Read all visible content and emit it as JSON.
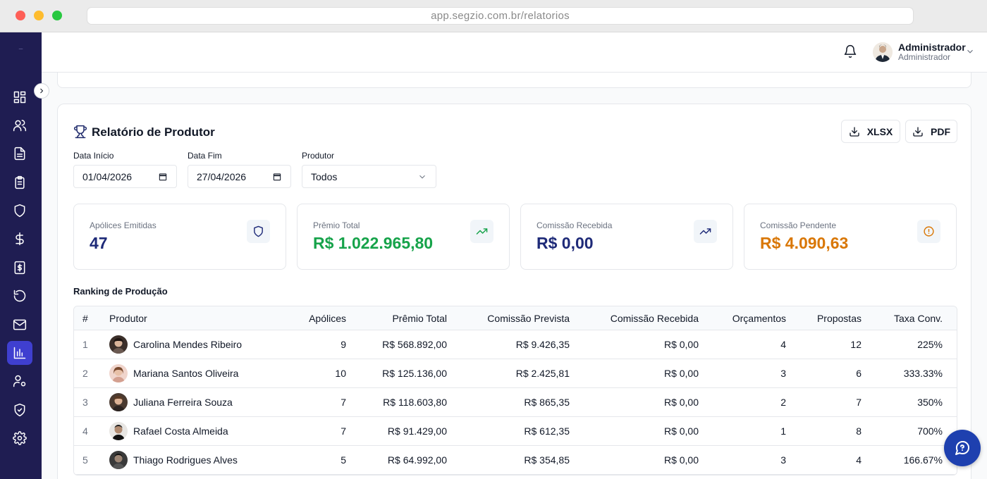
{
  "browser": {
    "url": "app.segzio.com.br/relatorios"
  },
  "sidebar": {
    "logo": "–",
    "items": [
      {
        "icon": "dashboard-icon",
        "active": false
      },
      {
        "icon": "users-icon",
        "active": false
      },
      {
        "icon": "document-icon",
        "active": false
      },
      {
        "icon": "clipboard-icon",
        "active": false
      },
      {
        "icon": "shield-icon",
        "active": false
      },
      {
        "icon": "dollar-icon",
        "active": false
      },
      {
        "icon": "money-doc-icon",
        "active": false
      },
      {
        "icon": "history-icon",
        "active": false
      },
      {
        "icon": "mail-icon",
        "active": false
      },
      {
        "icon": "bar-chart-icon",
        "active": true
      },
      {
        "icon": "user-settings-icon",
        "active": false
      },
      {
        "icon": "shield-check-icon",
        "active": false
      },
      {
        "icon": "gear-icon",
        "active": false
      }
    ]
  },
  "header": {
    "user_name": "Administrador",
    "user_role": "Administrador"
  },
  "report": {
    "title": "Relatório de Produtor",
    "export_xlsx": "XLSX",
    "export_pdf": "PDF",
    "filters": {
      "start_label": "Data Início",
      "start_value": "01/04/2026",
      "end_label": "Data Fim",
      "end_value": "27/04/2026",
      "producer_label": "Produtor",
      "producer_value": "Todos"
    },
    "kpis": [
      {
        "label": "Apólices Emitidas",
        "value": "47",
        "color": "#1e2a78",
        "icon": "shield-icon"
      },
      {
        "label": "Prêmio Total",
        "value": "R$ 1.022.965,80",
        "color": "#16a34a",
        "icon": "trending-up-icon"
      },
      {
        "label": "Comissão Recebida",
        "value": "R$ 0,00",
        "color": "#1e2a78",
        "icon": "trending-up-icon"
      },
      {
        "label": "Comissão Pendente",
        "value": "R$ 4.090,63",
        "color": "#d97706",
        "icon": "alert-circle-icon"
      }
    ],
    "ranking_title": "Ranking de Produção",
    "columns": [
      "#",
      "Produtor",
      "Apólices",
      "Prêmio Total",
      "Comissão Prevista",
      "Comissão Recebida",
      "Orçamentos",
      "Propostas",
      "Taxa Conv."
    ],
    "rows": [
      {
        "rank": "1",
        "name": "Carolina Mendes Ribeiro",
        "policies": "9",
        "premium": "R$ 568.892,00",
        "expected": "R$ 9.426,35",
        "received": "R$ 0,00",
        "quotes": "4",
        "proposals": "12",
        "rate": "225%"
      },
      {
        "rank": "2",
        "name": "Mariana Santos Oliveira",
        "policies": "10",
        "premium": "R$ 125.136,00",
        "expected": "R$ 2.425,81",
        "received": "R$ 0,00",
        "quotes": "3",
        "proposals": "6",
        "rate": "333.33%"
      },
      {
        "rank": "3",
        "name": "Juliana Ferreira Souza",
        "policies": "7",
        "premium": "R$ 118.603,80",
        "expected": "R$ 865,35",
        "received": "R$ 0,00",
        "quotes": "2",
        "proposals": "7",
        "rate": "350%"
      },
      {
        "rank": "4",
        "name": "Rafael Costa Almeida",
        "policies": "7",
        "premium": "R$ 91.429,00",
        "expected": "R$ 612,35",
        "received": "R$ 0,00",
        "quotes": "1",
        "proposals": "8",
        "rate": "700%"
      },
      {
        "rank": "5",
        "name": "Thiago Rodrigues Alves",
        "policies": "5",
        "premium": "R$ 64.992,00",
        "expected": "R$ 354,85",
        "received": "R$ 0,00",
        "quotes": "3",
        "proposals": "4",
        "rate": "166.67%"
      }
    ]
  }
}
